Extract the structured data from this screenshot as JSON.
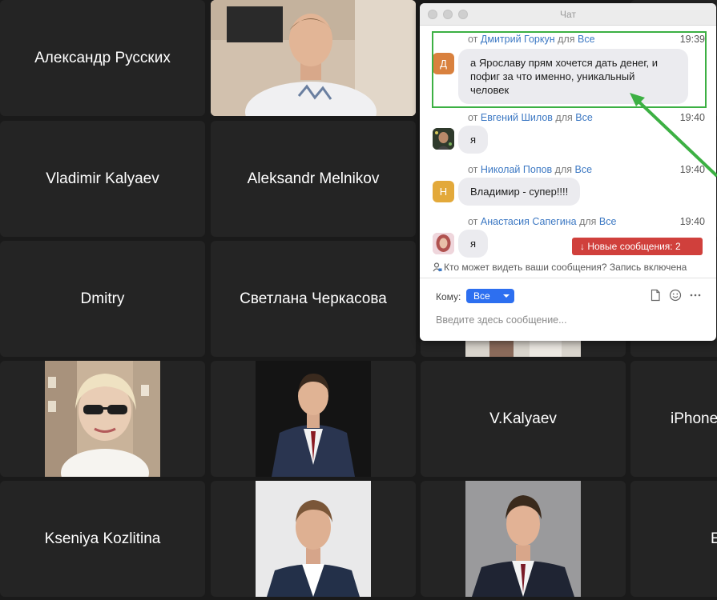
{
  "tiles": {
    "alexandr_russkikh": "Александр Русских",
    "vladimir_kalyaev": "Vladimir Kalyaev",
    "aleksandr_melnikov": "Aleksandr Melnikov",
    "dmitry": "Dmitry",
    "svetlana_cherkasova": "Светлана Черкасова",
    "v_kalyaev": "V.Kalyaev",
    "iphone": "iPhone",
    "kseniya_kozlitina": "Kseniya Kozlitina",
    "partial_right": "E"
  },
  "chat": {
    "title": "Чат",
    "from_word": "от",
    "to_word": "для",
    "messages": [
      {
        "sender": "Дмитрий Горкун",
        "recipient": "Все",
        "time": "19:39",
        "avatar_letter": "Д",
        "avatar_color": "#d9813e",
        "lines": [
          "а Ярославу прям хочется дать денег, и",
          "пофиг за что именно, уникальный",
          "человек"
        ]
      },
      {
        "sender": "Евгений Шилов",
        "recipient": "Все",
        "time": "19:40",
        "avatar_letter": "",
        "avatar_color": "#2f3a2c",
        "lines": [
          "я"
        ]
      },
      {
        "sender": "Николай Попов",
        "recipient": "Все",
        "time": "19:40",
        "avatar_letter": "Н",
        "avatar_color": "#e3a93a",
        "lines": [
          "Владимир - супер!!!!"
        ]
      },
      {
        "sender": "Анастасия Сапегина",
        "recipient": "Все",
        "time": "19:40",
        "avatar_letter": "",
        "avatar_color": "#e9b8c4",
        "lines": [
          "я"
        ]
      }
    ],
    "new_messages": "Новые сообщения: 2",
    "who_sees": "Кто может видеть ваши сообщения? Запись включена",
    "to_label": "Кому:",
    "to_value": "Все",
    "input_placeholder": "Введите здесь сообщение..."
  },
  "colors": {
    "highlight": "#3cb043",
    "link": "#3c78c3",
    "new_messages_bg": "#d0403c",
    "select_bg": "#2d6ff0",
    "tile_bg": "#242424"
  }
}
